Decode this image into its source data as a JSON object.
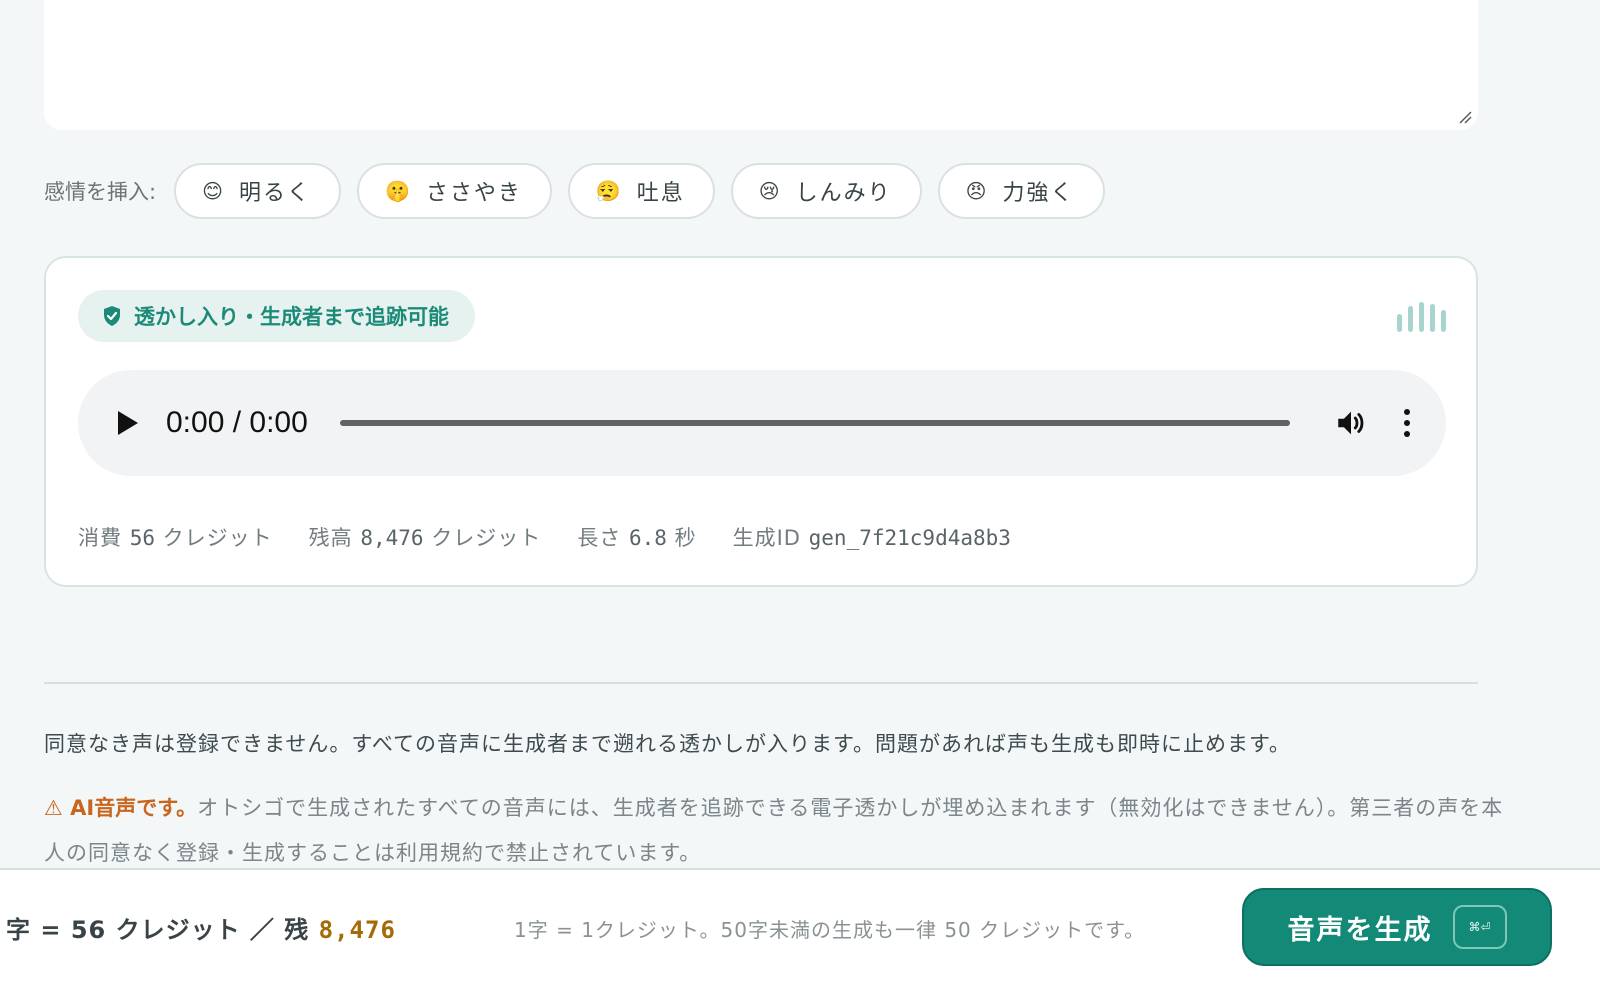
{
  "emotions": {
    "label": "感情を挿入:",
    "chips": [
      {
        "emoji": "😊",
        "label": "明るく"
      },
      {
        "emoji": "🤫",
        "label": "ささやき"
      },
      {
        "emoji": "😮‍💨",
        "label": "吐息"
      },
      {
        "emoji": "😢",
        "label": "しんみり"
      },
      {
        "emoji": "😠",
        "label": "力強く"
      }
    ]
  },
  "player": {
    "badge": "透かし入り・生成者まで追跡可能",
    "time": "0:00 / 0:00",
    "meta": {
      "consumed_label": "消費",
      "consumed_value": "56",
      "consumed_unit": "クレジット",
      "balance_label": "残高",
      "balance_value": "8,476",
      "balance_unit": "クレジット",
      "length_label": "長さ",
      "length_value": "6.8",
      "length_unit": "秒",
      "id_label": "生成ID",
      "id_value": "gen_7f21c9d4a8b3"
    }
  },
  "consent": "同意なき声は登録できません。すべての音声に生成者まで遡れる透かしが入ります。問題があれば声も生成も即時に止めます。",
  "notice": {
    "warn": "⚠ AI音声です。",
    "text": "オトシゴで生成されたすべての音声には、生成者を追跡できる電子透かしが埋め込まれます（無効化はできません）。第三者の声を本人の同意なく登録・生成することは利用規約で禁止されています。"
  },
  "footer": {
    "counter_prefix": "字 = 56 クレジット ／ 残",
    "counter_balance": "8,476",
    "rule": "1字 = 1クレジット。50字未満の生成も一律 50 クレジットです。",
    "generate_label": "音声を生成",
    "shortcut": "⌘⏎"
  },
  "colors": {
    "accent": "#138a78",
    "badge_text": "#1d8a78",
    "warning": "#c9651c",
    "balance": "#a46a08"
  }
}
